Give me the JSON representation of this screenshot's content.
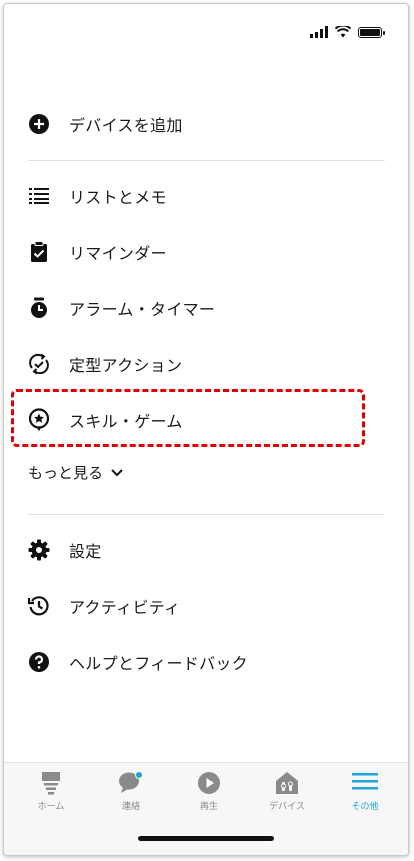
{
  "colors": {
    "accent": "#1fa5d6",
    "highlight": "#e00000",
    "inactive": "#8a8a8a"
  },
  "menu": {
    "add_device": {
      "label": "デバイスを追加",
      "icon": "plus-circle-icon"
    },
    "items": [
      {
        "label": "リストとメモ",
        "icon": "list-icon"
      },
      {
        "label": "リマインダー",
        "icon": "clipboard-check-icon"
      },
      {
        "label": "アラーム・タイマー",
        "icon": "alarm-clock-icon"
      },
      {
        "label": "定型アクション",
        "icon": "routine-check-icon"
      },
      {
        "label": "スキル・ゲーム",
        "icon": "skill-star-bubble-icon"
      }
    ],
    "see_more": "もっと見る",
    "bottom_items": [
      {
        "label": "設定",
        "icon": "gear-icon"
      },
      {
        "label": "アクティビティ",
        "icon": "history-icon"
      },
      {
        "label": "ヘルプとフィードバック",
        "icon": "help-icon"
      }
    ]
  },
  "tabs": [
    {
      "label": "ホーム",
      "icon": "home-icon",
      "active": false
    },
    {
      "label": "連絡",
      "icon": "chat-bubble-icon",
      "active": false
    },
    {
      "label": "再生",
      "icon": "play-icon",
      "active": false
    },
    {
      "label": "デバイス",
      "icon": "devices-icon",
      "active": false
    },
    {
      "label": "その他",
      "icon": "menu-icon",
      "active": true
    }
  ]
}
